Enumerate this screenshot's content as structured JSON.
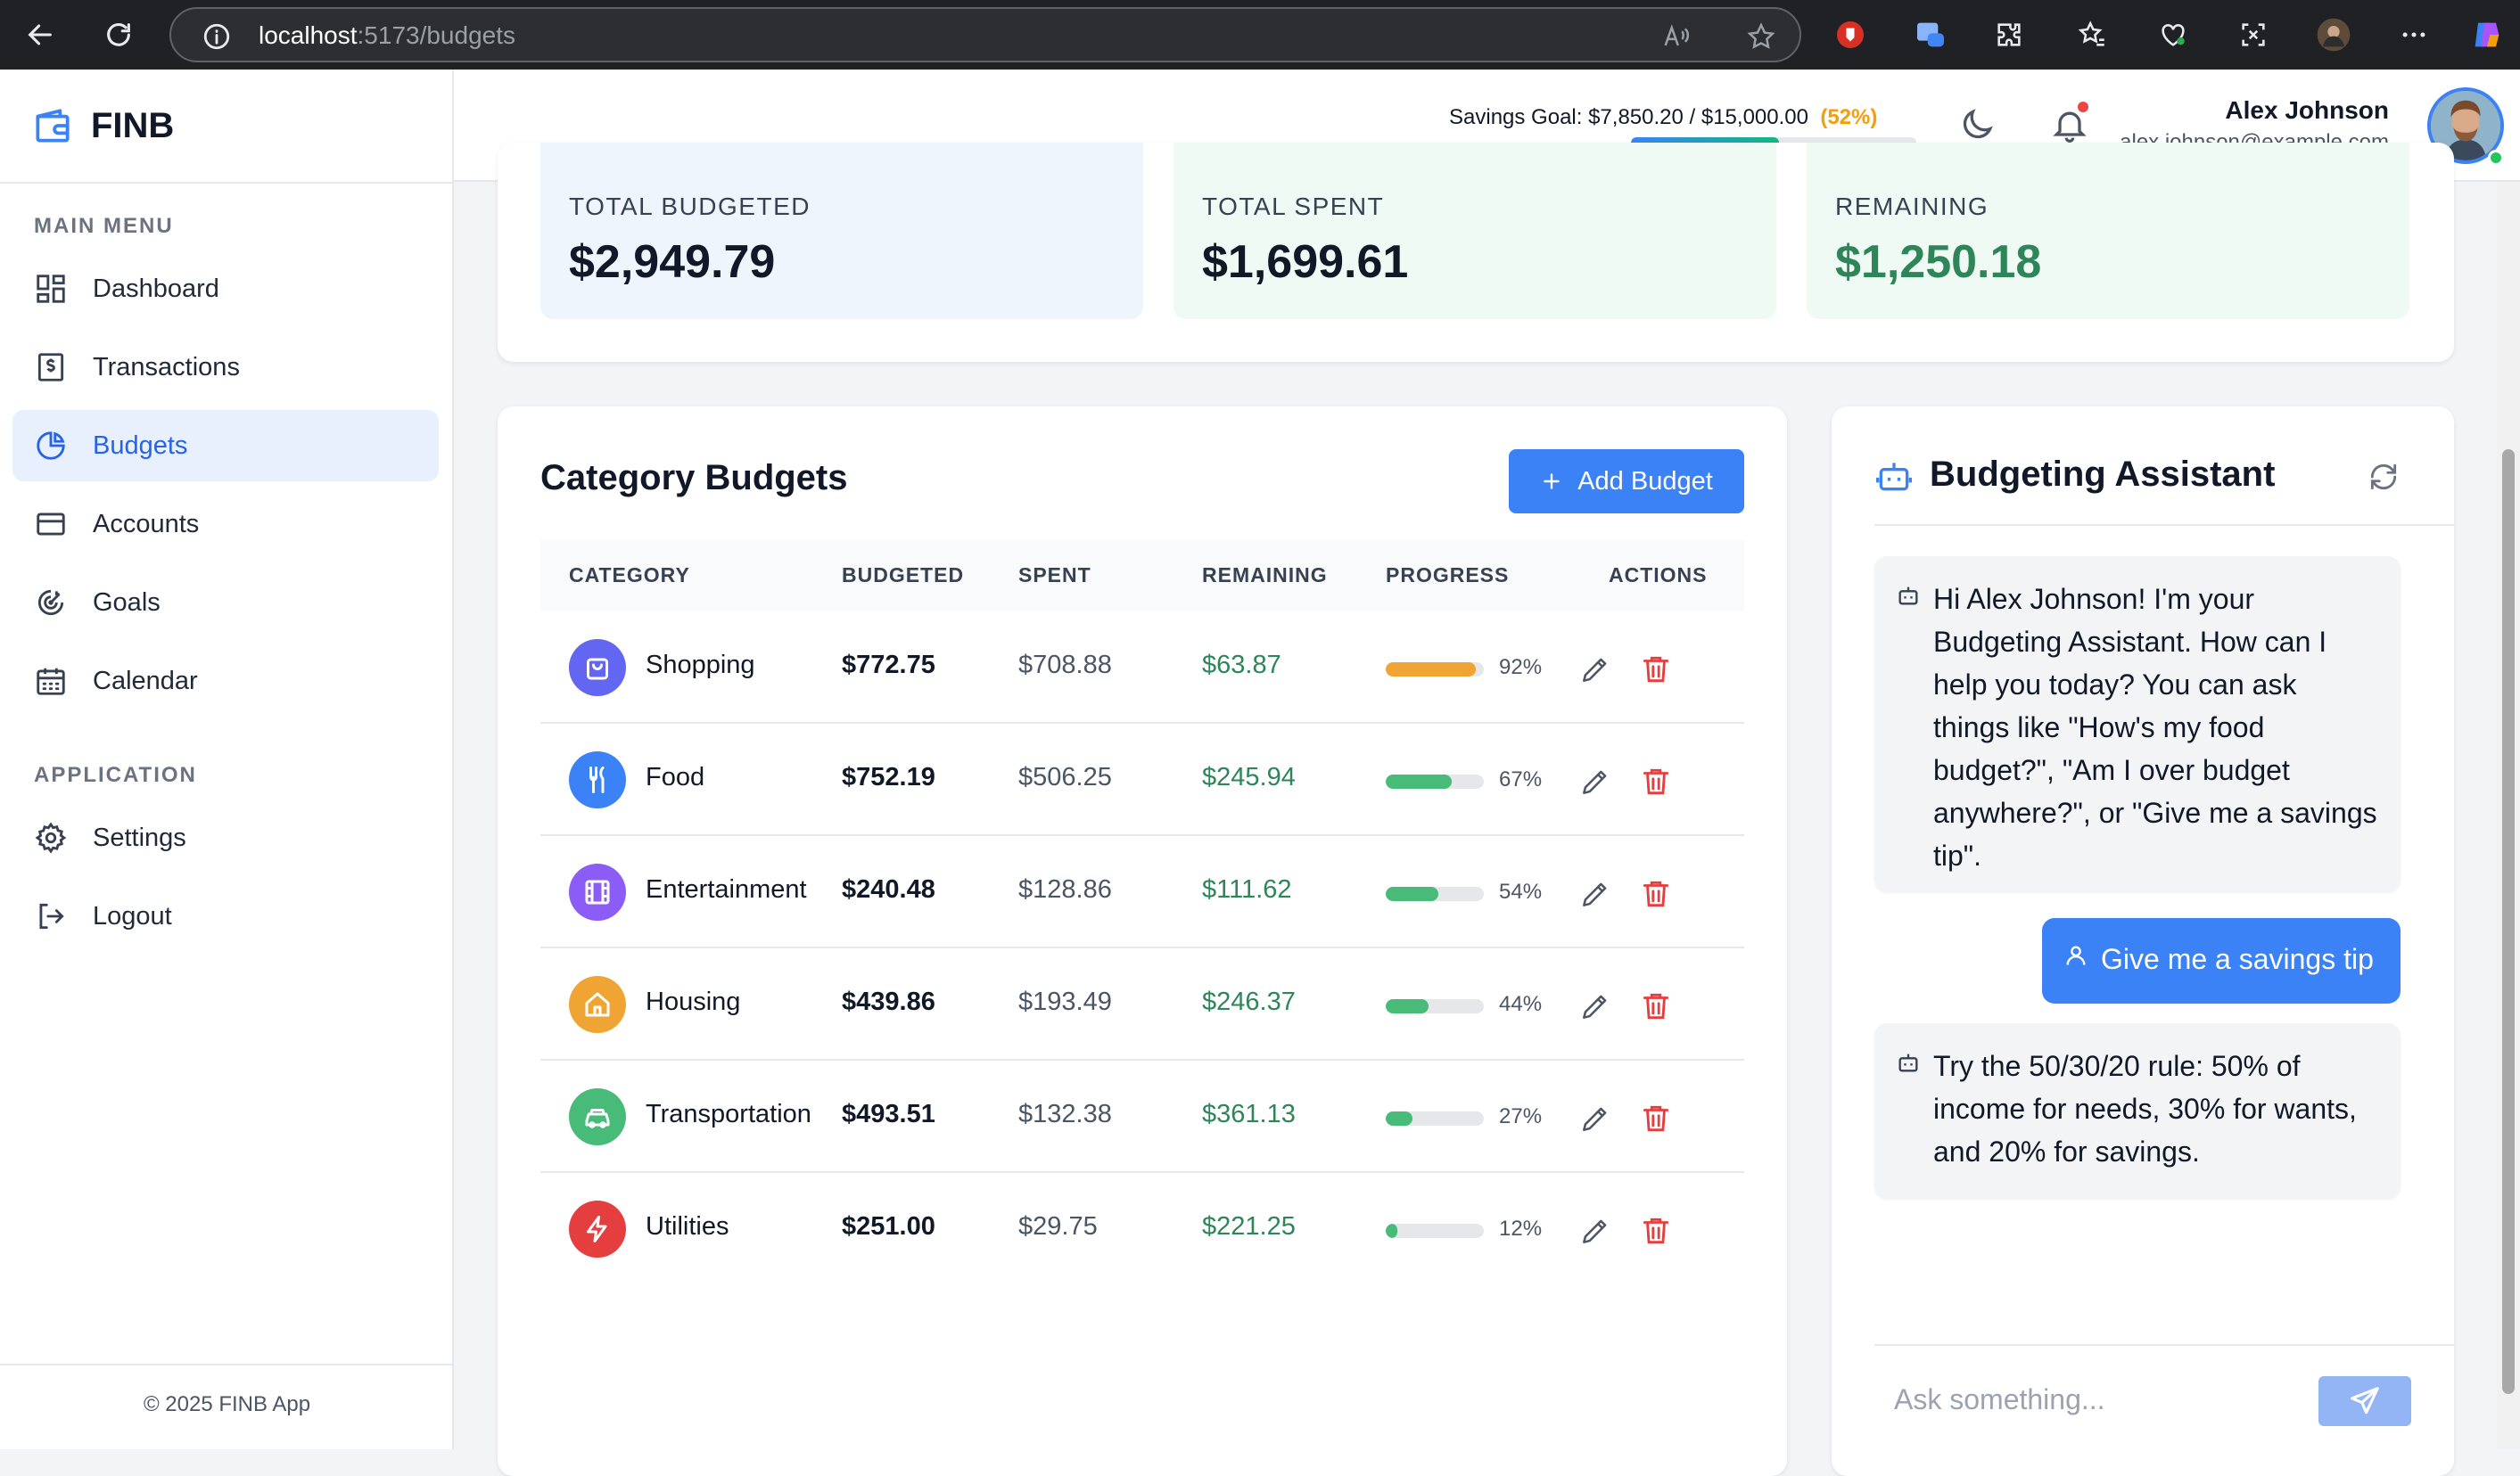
{
  "browser": {
    "url_host": "localhost",
    "url_path": ":5173/budgets"
  },
  "app": {
    "name": "FINB",
    "footer": "© 2025 FINB App"
  },
  "sidebar": {
    "main_menu_label": "MAIN MENU",
    "main_items": [
      {
        "label": "Dashboard",
        "icon": "dashboard-icon"
      },
      {
        "label": "Transactions",
        "icon": "receipt-icon"
      },
      {
        "label": "Budgets",
        "icon": "pie-chart-icon",
        "active": true
      },
      {
        "label": "Accounts",
        "icon": "credit-card-icon"
      },
      {
        "label": "Goals",
        "icon": "target-icon"
      },
      {
        "label": "Calendar",
        "icon": "calendar-icon"
      }
    ],
    "application_label": "APPLICATION",
    "app_items": [
      {
        "label": "Settings",
        "icon": "gear-icon"
      },
      {
        "label": "Logout",
        "icon": "logout-icon"
      }
    ]
  },
  "header": {
    "savings_text": "Savings Goal: $7,850.20 / $15,000.00",
    "savings_pct": "(52%)",
    "savings_progress": 0.52,
    "user_name": "Alex Johnson",
    "user_email": "alex.johnson@example.com"
  },
  "summary": {
    "total_budgeted_label": "TOTAL BUDGETED",
    "total_budgeted": "$2,949.79",
    "total_spent_label": "TOTAL SPENT",
    "total_spent": "$1,699.61",
    "remaining_label": "REMAINING",
    "remaining": "$1,250.18"
  },
  "category_budgets": {
    "title": "Category Budgets",
    "add_button": "Add Budget",
    "columns": [
      "CATEGORY",
      "BUDGETED",
      "SPENT",
      "REMAINING",
      "PROGRESS",
      "ACTIONS"
    ],
    "rows": [
      {
        "name": "Shopping",
        "icon": "shopping-bag-icon",
        "color": "#6366f1",
        "budgeted": "$772.75",
        "spent": "$708.88",
        "remaining": "$63.87",
        "progress": 0.92,
        "pct": "92%",
        "bar": "#f0a433"
      },
      {
        "name": "Food",
        "icon": "utensils-icon",
        "color": "#3b82f6",
        "budgeted": "$752.19",
        "spent": "$506.25",
        "remaining": "$245.94",
        "progress": 0.67,
        "pct": "67%",
        "bar": "#48bb78"
      },
      {
        "name": "Entertainment",
        "icon": "film-icon",
        "color": "#8b5cf6",
        "budgeted": "$240.48",
        "spent": "$128.86",
        "remaining": "$111.62",
        "progress": 0.54,
        "pct": "54%",
        "bar": "#48bb78"
      },
      {
        "name": "Housing",
        "icon": "home-icon",
        "color": "#f0a433",
        "budgeted": "$439.86",
        "spent": "$193.49",
        "remaining": "$246.37",
        "progress": 0.44,
        "pct": "44%",
        "bar": "#48bb78"
      },
      {
        "name": "Transportation",
        "icon": "car-icon",
        "color": "#48bb78",
        "budgeted": "$493.51",
        "spent": "$132.38",
        "remaining": "$361.13",
        "progress": 0.27,
        "pct": "27%",
        "bar": "#48bb78"
      },
      {
        "name": "Utilities",
        "icon": "lightning-icon",
        "color": "#e53e3e",
        "budgeted": "$251.00",
        "spent": "$29.75",
        "remaining": "$221.25",
        "progress": 0.12,
        "pct": "12%",
        "bar": "#48bb78"
      }
    ]
  },
  "assistant": {
    "title": "Budgeting Assistant",
    "messages": [
      {
        "from": "bot",
        "text": "Hi Alex Johnson! I'm your Budgeting Assistant. How can I help you today? You can ask things like \"How's my food budget?\", \"Am I over budget anywhere?\", or \"Give me a savings tip\"."
      },
      {
        "from": "user",
        "text": "Give me a savings tip"
      },
      {
        "from": "bot",
        "text": "Try the 50/30/20 rule: 50% of income for needs, 30% for wants, and 20% for savings."
      }
    ],
    "input_placeholder": "Ask something..."
  },
  "colors": {
    "accent": "#3b82f6",
    "positive": "#2f855a",
    "danger": "#e53e3e",
    "warning": "#f59e0b"
  }
}
